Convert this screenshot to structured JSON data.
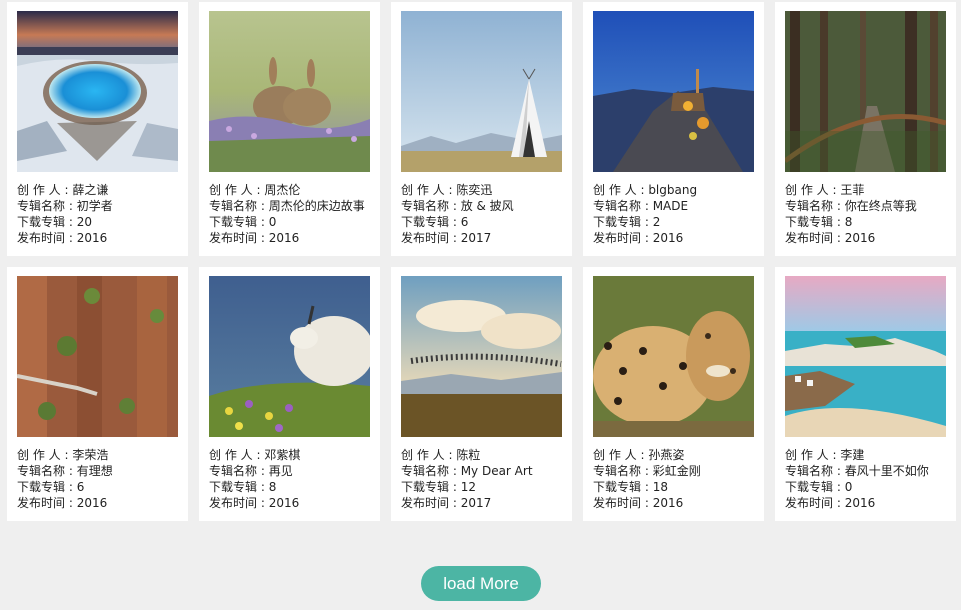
{
  "labels": {
    "author": "创 作 人 : ",
    "album": "专辑名称 : ",
    "downloads": "下载专辑 : ",
    "year": "发布时间 : "
  },
  "albums": [
    {
      "author": "薛之谦",
      "album": "初学者",
      "downloads": "20",
      "year": "2016",
      "image": "hot-spring-landscape"
    },
    {
      "author": "周杰伦",
      "album": "周杰伦的床边故事",
      "downloads": "0",
      "year": "2016",
      "image": "rabbits-in-flowers"
    },
    {
      "author": "陈奕迅",
      "album": "放 & 披风",
      "downloads": "6",
      "year": "2017",
      "image": "teepee-prairie"
    },
    {
      "author": "blgbang",
      "album": "MADE",
      "downloads": "2",
      "year": "2016",
      "image": "hilltop-town-night"
    },
    {
      "author": "王菲",
      "album": "你在终点等我",
      "downloads": "8",
      "year": "2016",
      "image": "forest-path"
    },
    {
      "author": "李荣浩",
      "album": "有理想",
      "downloads": "6",
      "year": "2016",
      "image": "cliff-road"
    },
    {
      "author": "邓紫棋",
      "album": "再见",
      "downloads": "8",
      "year": "2016",
      "image": "mountain-goat"
    },
    {
      "author": "陈粒",
      "album": "My Dear Art",
      "downloads": "12",
      "year": "2017",
      "image": "bird-flock-mountains"
    },
    {
      "author": "孙燕姿",
      "album": "彩虹金刚",
      "downloads": "18",
      "year": "2016",
      "image": "cheetahs"
    },
    {
      "author": "李建",
      "album": "春风十里不如你",
      "downloads": "0",
      "year": "2016",
      "image": "coastal-village"
    }
  ],
  "load_more_label": "load More",
  "colors": {
    "accent": "#4cb5a4",
    "page_bg": "#efefef",
    "card_bg": "#ffffff"
  }
}
